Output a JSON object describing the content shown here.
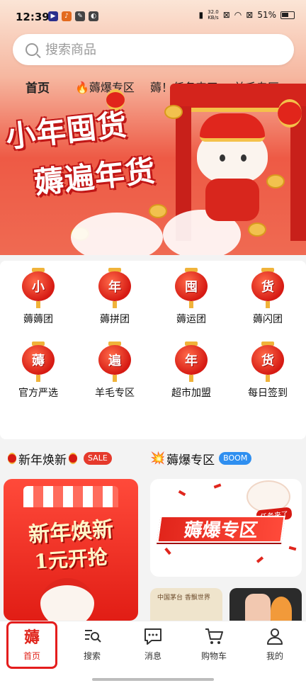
{
  "status_bar": {
    "time": "12:39",
    "net_speed_value": "32.0",
    "net_speed_unit": "KB/s",
    "battery": "51%"
  },
  "search": {
    "placeholder": "搜索商品"
  },
  "tabs": [
    {
      "label": "首页"
    },
    {
      "label": "薅爆专区"
    },
    {
      "label": "薅！任务来了"
    },
    {
      "label": "羊毛专区"
    }
  ],
  "banner": {
    "line1": "小年囤货",
    "line2": "薅遍年货"
  },
  "grid": [
    {
      "char": "小",
      "label": "薅薅团"
    },
    {
      "char": "年",
      "label": "薅拼团"
    },
    {
      "char": "囤",
      "label": "薅运团"
    },
    {
      "char": "货",
      "label": "薅闪团"
    },
    {
      "char": "薅",
      "label": "官方严选"
    },
    {
      "char": "遍",
      "label": "羊毛专区"
    },
    {
      "char": "年",
      "label": "超市加盟"
    },
    {
      "char": "货",
      "label": "每日签到"
    }
  ],
  "sections": {
    "left": {
      "title": "新年焕新",
      "badge": "SALE",
      "card_line1": "新年焕新",
      "card_line2": "1元开抢"
    },
    "right": {
      "title": "薅爆专区",
      "badge": "BOOM",
      "card_title": "薅爆专区",
      "card_tag": "任务来了",
      "mini_a_title": "中国茅台 香飘世界"
    }
  },
  "bottom_nav": [
    {
      "label": "首页",
      "icon": "home-logo-icon",
      "active": true
    },
    {
      "label": "搜索",
      "icon": "search-list-icon",
      "active": false
    },
    {
      "label": "消息",
      "icon": "message-icon",
      "active": false
    },
    {
      "label": "购物车",
      "icon": "cart-icon",
      "active": false
    },
    {
      "label": "我的",
      "icon": "profile-icon",
      "active": false
    }
  ],
  "colors": {
    "brand_red": "#e0261d",
    "sale_badge": "#e53a2c",
    "boom_badge": "#2f8ff0"
  }
}
